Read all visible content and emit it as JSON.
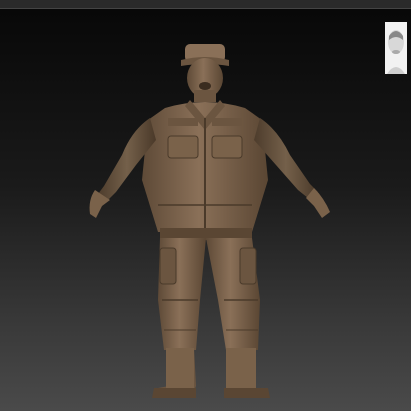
{
  "viewport": {
    "background_top": "#070707",
    "background_bottom": "#4a4a4a"
  },
  "model": {
    "material_color": "#7a624a",
    "highlight_color": "#9a806a",
    "shadow_color": "#4a3a2a"
  },
  "icons": {
    "gizmo": "head-orientation-icon"
  }
}
